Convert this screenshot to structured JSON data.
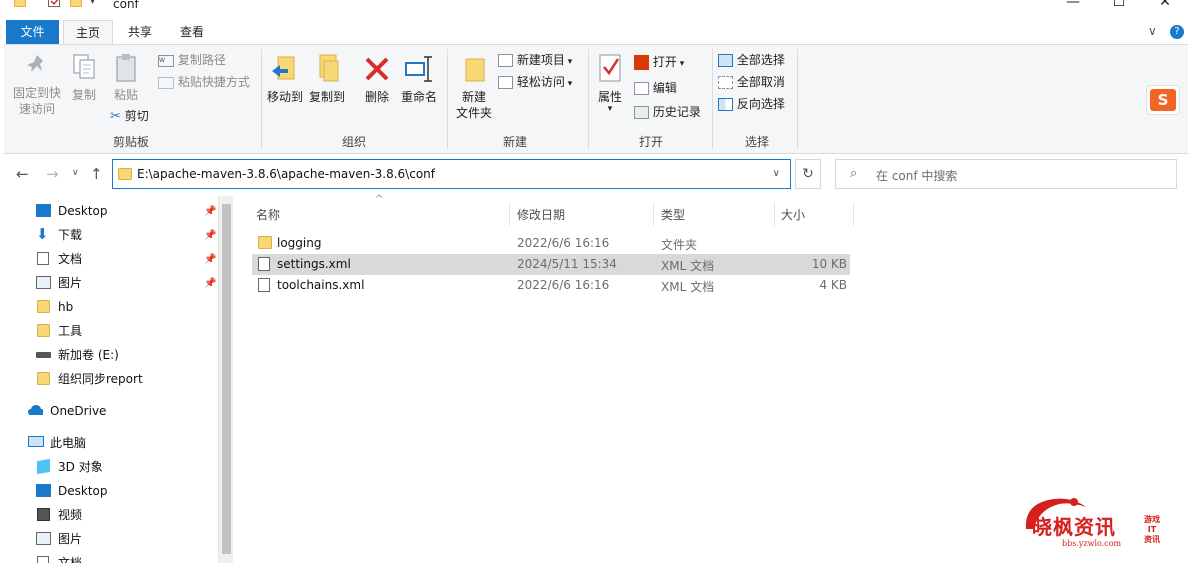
{
  "window": {
    "title": "conf",
    "controls": {
      "minimize": "—",
      "maximize": "☐",
      "close": "✕"
    }
  },
  "tabs": [
    {
      "label": "文件"
    },
    {
      "label": "主页"
    },
    {
      "label": "共享"
    },
    {
      "label": "查看"
    }
  ],
  "tab_controls": {
    "expand": "∨",
    "help": "?"
  },
  "ribbon": {
    "clipboard": {
      "group_label": "剪贴板",
      "pin_quick_access": "固定到快\n速访问",
      "copy": "复制",
      "paste": "粘贴",
      "copy_path": "复制路径",
      "paste_shortcut": "粘贴快捷方式",
      "cut": "剪切"
    },
    "organize": {
      "group_label": "组织",
      "move_to": "移动到",
      "copy_to": "复制到",
      "delete": "删除",
      "rename": "重命名"
    },
    "new": {
      "group_label": "新建",
      "new_folder": "新建\n文件夹",
      "new_item": "新建项目",
      "easy_access": "轻松访问"
    },
    "open": {
      "group_label": "打开",
      "properties": "属性",
      "open": "打开",
      "edit": "编辑",
      "history": "历史记录"
    },
    "select": {
      "group_label": "选择",
      "select_all": "全部选择",
      "select_none": "全部取消",
      "invert": "反向选择"
    }
  },
  "address_bar": {
    "path": "E:\\apache-maven-3.8.6\\apache-maven-3.8.6\\conf",
    "search_placeholder": "在 conf 中搜索"
  },
  "nav_pane": {
    "quick_access": [
      {
        "label": "Desktop",
        "icon": "desktop-icon",
        "pinned": true
      },
      {
        "label": "下载",
        "icon": "download-icon",
        "pinned": true
      },
      {
        "label": "文档",
        "icon": "document-icon",
        "pinned": true
      },
      {
        "label": "图片",
        "icon": "picture-icon",
        "pinned": true
      },
      {
        "label": "hb",
        "icon": "folder-icon",
        "pinned": false
      },
      {
        "label": "工具",
        "icon": "folder-icon",
        "pinned": false
      },
      {
        "label": "新加卷 (E:)",
        "icon": "drive-icon",
        "pinned": false
      },
      {
        "label": "组织同步report",
        "icon": "folder-icon",
        "pinned": false
      }
    ],
    "onedrive": "OneDrive",
    "this_pc": "此电脑",
    "this_pc_items": [
      {
        "label": "3D 对象",
        "icon": "cube-icon"
      },
      {
        "label": "Desktop",
        "icon": "desktop-icon"
      },
      {
        "label": "视频",
        "icon": "video-icon"
      },
      {
        "label": "图片",
        "icon": "picture-icon"
      },
      {
        "label": "文档",
        "icon": "document-icon"
      }
    ]
  },
  "file_list": {
    "columns": [
      "名称",
      "修改日期",
      "类型",
      "大小"
    ],
    "sort_indicator": "^",
    "rows": [
      {
        "name": "logging",
        "date": "2022/6/6 16:16",
        "type": "文件夹",
        "size": "",
        "icon": "folder-icon",
        "selected": false
      },
      {
        "name": "settings.xml",
        "date": "2024/5/11 15:34",
        "type": "XML 文档",
        "size": "10 KB",
        "icon": "xml-file-icon",
        "selected": true
      },
      {
        "name": "toolchains.xml",
        "date": "2022/6/6 16:16",
        "type": "XML 文档",
        "size": "4 KB",
        "icon": "xml-file-icon",
        "selected": false
      }
    ]
  },
  "watermark": {
    "name": "晓枫资讯",
    "url": "bbs.yzwlo.com",
    "side": "游戏\nIT\n资讯"
  },
  "colors": {
    "accent": "#1979ca",
    "selection": "#d9d9d9",
    "folder": "#f8d775",
    "ribbon_bg": "#f5f6f7",
    "watermark_red": "#d6201e"
  }
}
